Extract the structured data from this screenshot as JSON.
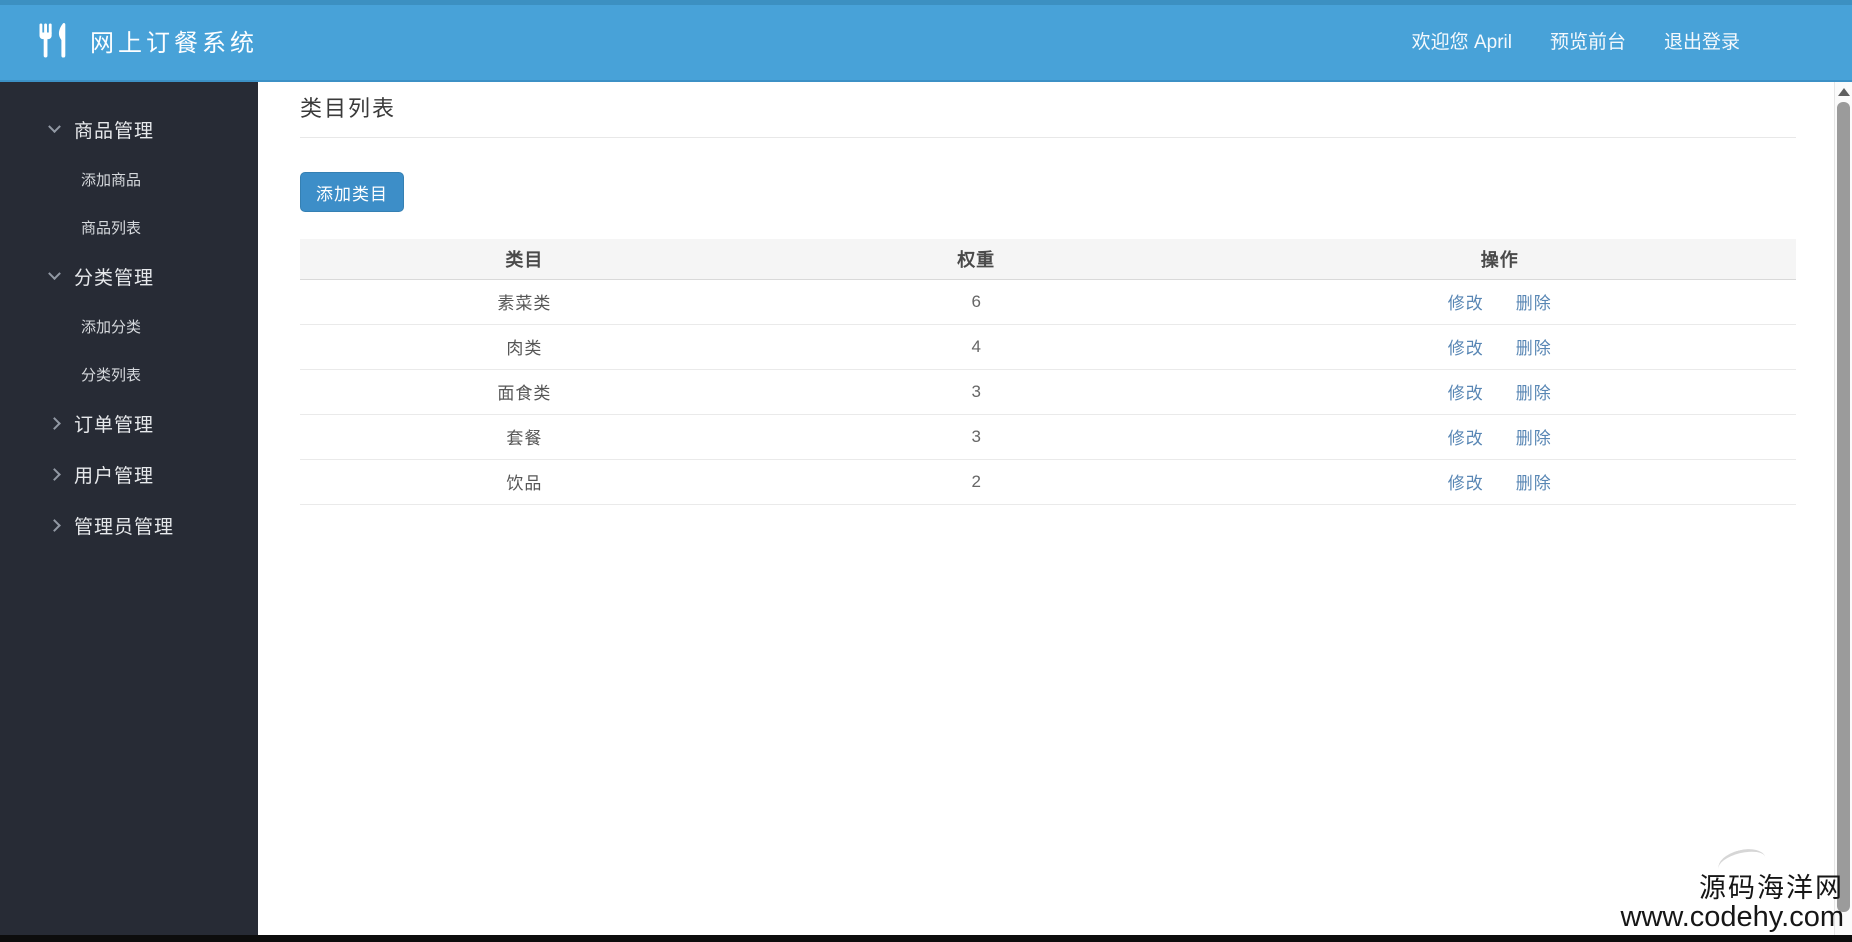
{
  "header": {
    "title": "网上订餐系统",
    "welcome_text": "欢迎您  April",
    "preview_label": "预览前台",
    "logout_label": "退出登录"
  },
  "sidebar": {
    "groups": [
      {
        "label": "商品管理",
        "expanded": true,
        "children": [
          "添加商品",
          "商品列表"
        ]
      },
      {
        "label": "分类管理",
        "expanded": true,
        "children": [
          "添加分类",
          "分类列表"
        ]
      },
      {
        "label": "订单管理",
        "expanded": false,
        "children": []
      },
      {
        "label": "用户管理",
        "expanded": false,
        "children": []
      },
      {
        "label": "管理员管理",
        "expanded": false,
        "children": []
      }
    ]
  },
  "main": {
    "page_title": "类目列表",
    "add_button_label": "添加类目",
    "table": {
      "columns": [
        "类目",
        "权重",
        "操作"
      ],
      "rows": [
        {
          "category": "素菜类",
          "weight": "6"
        },
        {
          "category": "肉类",
          "weight": "4"
        },
        {
          "category": "面食类",
          "weight": "3"
        },
        {
          "category": "套餐",
          "weight": "3"
        },
        {
          "category": "饮品",
          "weight": "2"
        }
      ],
      "edit_label": "修改",
      "delete_label": "删除"
    }
  },
  "watermark": {
    "line1": "源码海洋网",
    "line2": "www.codehy.com"
  },
  "colors": {
    "header_bg": "#48a2d8",
    "sidebar_bg": "#272b35",
    "button_bg": "#3d8ec8",
    "link": "#5886b4",
    "table_header_bg": "#f5f5f5"
  }
}
